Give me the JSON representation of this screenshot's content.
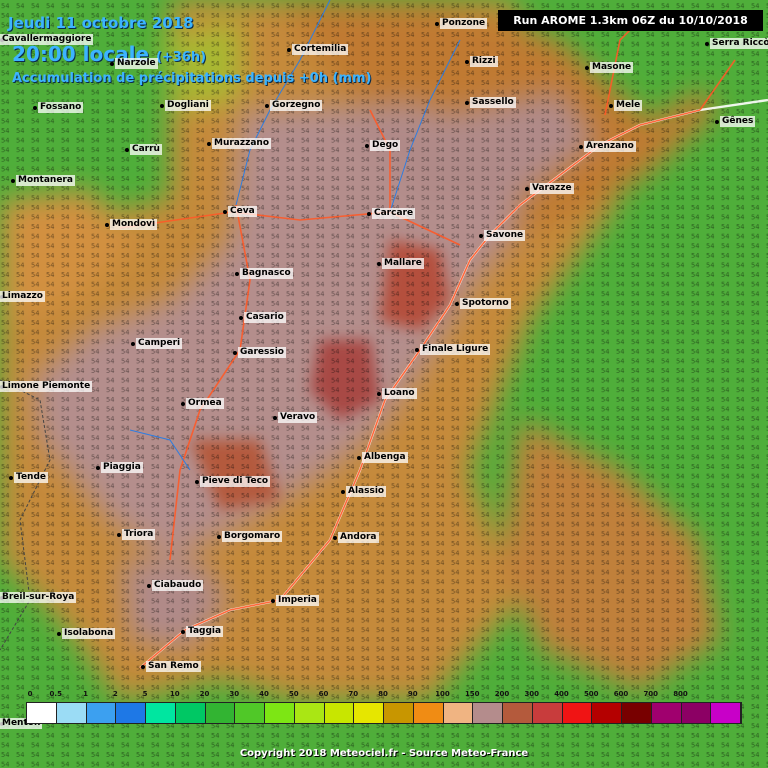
{
  "header": {
    "date": "Jeudi 11 octobre 2018",
    "time": "20:00 locale",
    "offset": "(+36h)",
    "field": "Accumulation de précipitations depuis +0h (mm)",
    "run": "Run AROME 1.3km 06Z du 10/10/2018"
  },
  "cities": [
    {
      "name": "Ponzone"
    },
    {
      "name": "Serra Riccò"
    },
    {
      "name": "Cortemilia"
    },
    {
      "name": "Narzole"
    },
    {
      "name": "Cavallermaggiore"
    },
    {
      "name": "Rizzi"
    },
    {
      "name": "Masone"
    },
    {
      "name": "Mele"
    },
    {
      "name": "Fossano"
    },
    {
      "name": "Dogliani"
    },
    {
      "name": "Gorzegno"
    },
    {
      "name": "Sassello"
    },
    {
      "name": "Gênes"
    },
    {
      "name": "Carrù"
    },
    {
      "name": "Murazzano"
    },
    {
      "name": "Dego"
    },
    {
      "name": "Arenzano"
    },
    {
      "name": "Montanera"
    },
    {
      "name": "Varazze"
    },
    {
      "name": "Ceva"
    },
    {
      "name": "Carcare"
    },
    {
      "name": "Mondovì"
    },
    {
      "name": "Savone"
    },
    {
      "name": "Bagnasco"
    },
    {
      "name": "Mallare"
    },
    {
      "name": "Limazzo"
    },
    {
      "name": "Spotorno"
    },
    {
      "name": "Casario"
    },
    {
      "name": "Camperi"
    },
    {
      "name": "Garessio"
    },
    {
      "name": "Finale Ligure"
    },
    {
      "name": "Limone Piemonte"
    },
    {
      "name": "Loano"
    },
    {
      "name": "Ormea"
    },
    {
      "name": "Veravo"
    },
    {
      "name": "Albenga"
    },
    {
      "name": "Piaggia"
    },
    {
      "name": "Tende"
    },
    {
      "name": "Pieve di Teco"
    },
    {
      "name": "Alassio"
    },
    {
      "name": "Triora"
    },
    {
      "name": "Borgomaro"
    },
    {
      "name": "Andora"
    },
    {
      "name": "Ciabaudo"
    },
    {
      "name": "Breil-sur-Roya"
    },
    {
      "name": "Imperia"
    },
    {
      "name": "Isolabona"
    },
    {
      "name": "Taggia"
    },
    {
      "name": "San Remo"
    },
    {
      "name": "Menton"
    }
  ],
  "legend": {
    "levels": [
      "0",
      "0.5",
      "1",
      "2",
      "5",
      "10",
      "20",
      "30",
      "40",
      "50",
      "60",
      "70",
      "80",
      "90",
      "100",
      "150",
      "200",
      "300",
      "400",
      "500",
      "600",
      "700",
      "800"
    ],
    "colors": [
      "#ffffff",
      "#9bdcf5",
      "#3ca0f0",
      "#1e78e6",
      "#00e6a0",
      "#00c864",
      "#32b432",
      "#50c828",
      "#7de614",
      "#aae614",
      "#c8e600",
      "#e6e600",
      "#c89600",
      "#f08c14",
      "#f0b482",
      "#b48c8c",
      "#b45a3c",
      "#c83c3c",
      "#f01414",
      "#b40000",
      "#780000",
      "#a0006e",
      "#8c0064",
      "#c800c8"
    ]
  },
  "footer": "Copyright 2018 Meteociel.fr - Source Meteo-France"
}
